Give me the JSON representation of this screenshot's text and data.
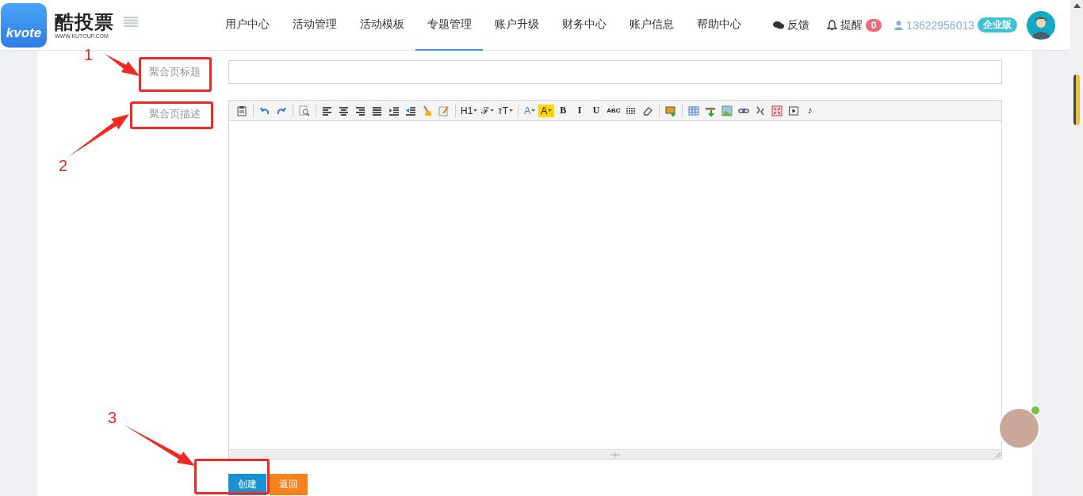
{
  "header": {
    "logo_mark": "kvote",
    "brand": "酷投票",
    "domain": "WWW.KUTOUP.COM",
    "nav": [
      {
        "label": "用户中心",
        "selected": false
      },
      {
        "label": "活动管理",
        "selected": false
      },
      {
        "label": "活动模板",
        "selected": false
      },
      {
        "label": "专题管理",
        "selected": true
      },
      {
        "label": "账户升级",
        "selected": false
      },
      {
        "label": "财务中心",
        "selected": false
      },
      {
        "label": "账户信息",
        "selected": false
      },
      {
        "label": "帮助中心",
        "selected": false
      }
    ],
    "feedback": "反馈",
    "reminder": "提醒",
    "reminder_count": "0",
    "phone": "13622956013",
    "edition": "企业版"
  },
  "form": {
    "title_label": "聚合页标题",
    "description_label": "聚合页描述",
    "toolbar": [
      {
        "kind": "paste"
      },
      {
        "kind": "sep"
      },
      {
        "kind": "undo"
      },
      {
        "kind": "redo"
      },
      {
        "kind": "sep"
      },
      {
        "kind": "preview"
      },
      {
        "kind": "sep"
      },
      {
        "kind": "align-left"
      },
      {
        "kind": "align-center"
      },
      {
        "kind": "align-right"
      },
      {
        "kind": "justify"
      },
      {
        "kind": "indent"
      },
      {
        "kind": "outdent"
      },
      {
        "kind": "brush"
      },
      {
        "kind": "format"
      },
      {
        "kind": "sep"
      },
      {
        "kind": "menu",
        "label": "H1"
      },
      {
        "kind": "menu",
        "label": "ℱ"
      },
      {
        "kind": "menu",
        "label": "тT"
      },
      {
        "kind": "sep"
      },
      {
        "kind": "color-menu",
        "label": "A"
      },
      {
        "kind": "highlight-menu",
        "label": "A"
      },
      {
        "kind": "text",
        "label": "B"
      },
      {
        "kind": "text",
        "label": "I"
      },
      {
        "kind": "text",
        "label": "U"
      },
      {
        "kind": "small-text",
        "label": "ABC"
      },
      {
        "kind": "grid"
      },
      {
        "kind": "eraser"
      },
      {
        "kind": "sep"
      },
      {
        "kind": "image-add"
      },
      {
        "kind": "sep"
      },
      {
        "kind": "table"
      },
      {
        "kind": "row-add"
      },
      {
        "kind": "picture"
      },
      {
        "kind": "link"
      },
      {
        "kind": "unlink"
      },
      {
        "kind": "fullscreen"
      },
      {
        "kind": "video"
      },
      {
        "kind": "text",
        "label": "♪"
      }
    ],
    "buttons": [
      {
        "label": "创建",
        "kind": "primary"
      },
      {
        "label": "返回",
        "kind": "warning"
      }
    ]
  },
  "annotations": [
    {
      "number": "1"
    },
    {
      "number": "2"
    },
    {
      "number": "3"
    }
  ]
}
